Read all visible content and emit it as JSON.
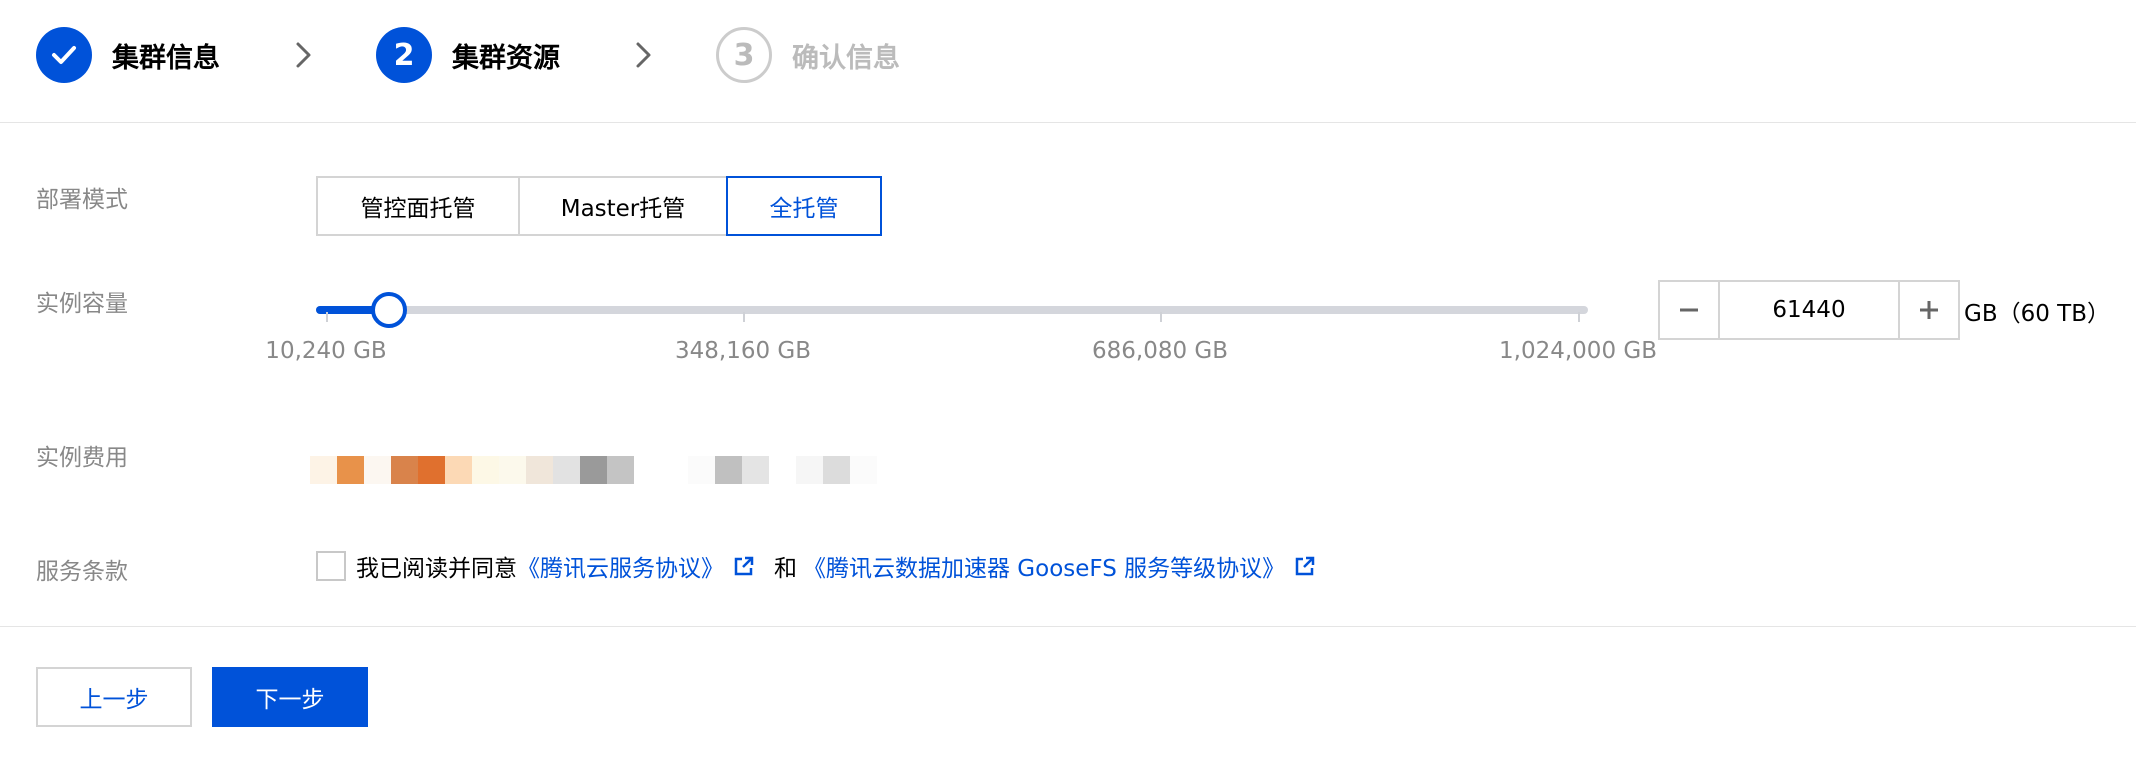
{
  "steps": [
    {
      "number": "1",
      "label": "集群信息",
      "status": "done"
    },
    {
      "number": "2",
      "label": "集群资源",
      "status": "active"
    },
    {
      "number": "3",
      "label": "确认信息",
      "status": "todo"
    }
  ],
  "form": {
    "deploy_mode": {
      "label": "部署模式",
      "options": [
        "管控面托管",
        "Master托管",
        "全托管"
      ],
      "selected": "全托管"
    },
    "capacity": {
      "label": "实例容量",
      "slider": {
        "min": 10240,
        "max": 1024000,
        "value": 61440,
        "marks": [
          "10,240 GB",
          "348,160 GB",
          "686,080 GB",
          "1,024,000 GB"
        ]
      },
      "input_value": "61440",
      "decrement_label": "−",
      "increment_label": "+",
      "unit": "GB（60 TB）"
    },
    "fee": {
      "label": "实例费用",
      "value_obscured": true
    },
    "terms": {
      "label": "服务条款",
      "checked": false,
      "prefix": "我已阅读并同意",
      "link1": "《腾讯云服务协议》",
      "and": "和",
      "link2": "《腾讯云数据加速器 GooseFS 服务等级协议》"
    }
  },
  "footer": {
    "prev_label": "上一步",
    "next_label": "下一步"
  },
  "colors": {
    "primary": "#0052d9",
    "label_gray": "#888888",
    "border": "#d4d4d4",
    "step_todo": "#bbbbbb"
  },
  "icons": {
    "step_done": "check-icon",
    "step_separator": "chevron-right-icon",
    "external_link": "external-link-icon",
    "decrement": "minus-icon",
    "increment": "plus-icon"
  }
}
